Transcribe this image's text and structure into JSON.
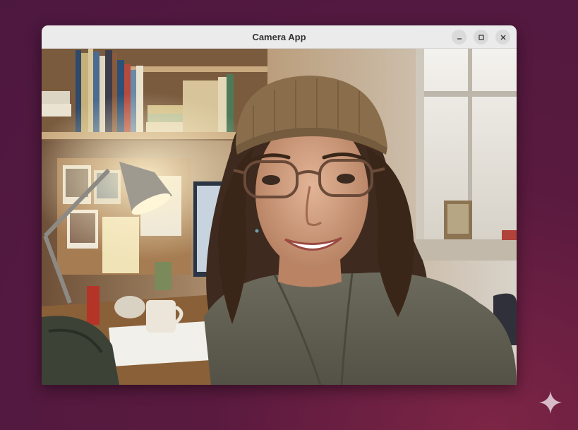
{
  "window": {
    "title": "Camera App",
    "controls": {
      "minimize": "minimize-icon",
      "maximize": "maximize-icon",
      "close": "close-icon"
    }
  },
  "camera": {
    "feed": "live-camera-preview"
  },
  "colors": {
    "desktop_bg": "#5a1a3f",
    "titlebar_bg": "#ebebeb",
    "control_bg": "#dadada"
  },
  "desktop": {
    "overlay_icon": "sparkle-icon"
  }
}
